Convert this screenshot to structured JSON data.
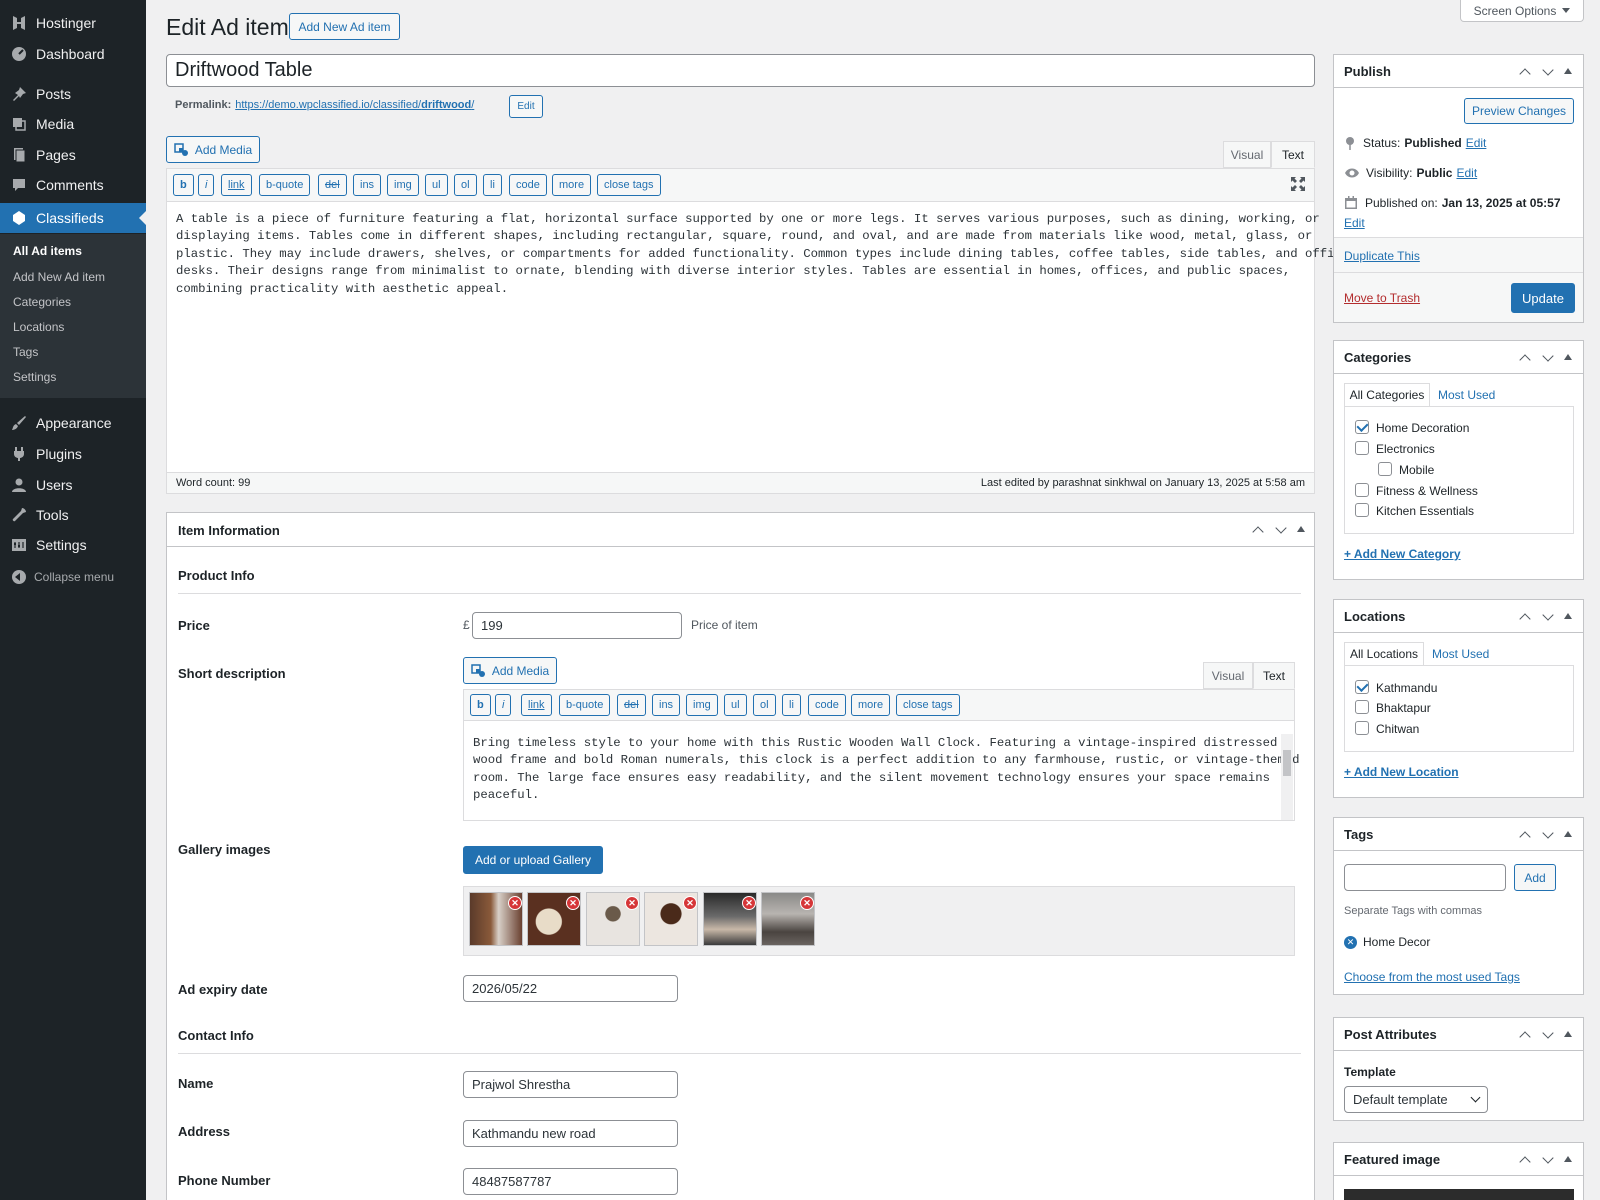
{
  "screen_options": "Screen Options",
  "sidebar": {
    "brand": "Hostinger",
    "items": [
      {
        "label": "Dashboard"
      },
      {
        "label": "Posts"
      },
      {
        "label": "Media"
      },
      {
        "label": "Pages"
      },
      {
        "label": "Comments"
      },
      {
        "label": "Classifieds"
      },
      {
        "label": "Appearance"
      },
      {
        "label": "Plugins"
      },
      {
        "label": "Users"
      },
      {
        "label": "Tools"
      },
      {
        "label": "Settings"
      }
    ],
    "submenu": [
      "All Ad items",
      "Add New Ad item",
      "Categories",
      "Locations",
      "Tags",
      "Settings"
    ],
    "collapse": "Collapse menu"
  },
  "header": {
    "title": "Edit Ad item",
    "add_new": "Add New Ad item"
  },
  "post": {
    "title": "Driftwood Table",
    "permalink_label": "Permalink:",
    "permalink_base": "https://demo.wpclassified.io/classified/",
    "permalink_slug": "driftwood",
    "permalink_end": "/",
    "permalink_edit": "Edit"
  },
  "editor": {
    "add_media": "Add Media",
    "tab_visual": "Visual",
    "tab_text": "Text",
    "quicktags": [
      "b",
      "i",
      "link",
      "b-quote",
      "del",
      "ins",
      "img",
      "ul",
      "ol",
      "li",
      "code",
      "more",
      "close tags"
    ],
    "content": "A table is a piece of furniture featuring a flat, horizontal surface supported by one or more legs. It serves various purposes, such as dining, working, or\ndisplaying items. Tables come in different shapes, including rectangular, square, round, and oval, and are made from materials like wood, metal, glass, or\nplastic. They may include drawers, shelves, or compartments for added functionality. Common types include dining tables, coffee tables, side tables, and office\ndesks. Their designs range from minimalist to ornate, blending with diverse interior styles. Tables are essential in homes, offices, and public spaces,\ncombining practicality with aesthetic appeal.",
    "word_count": "Word count: 99",
    "last_edited": "Last edited by parashnat sinkhwal on January 13, 2025 at 5:58 am"
  },
  "item_info": {
    "title": "Item Information",
    "product_info": "Product Info",
    "price_label": "Price",
    "currency": "£",
    "price_value": "199",
    "price_hint": "Price of item",
    "short_desc_label": "Short description",
    "short_desc_content": "Bring timeless style to your home with this Rustic Wooden Wall Clock. Featuring a vintage-inspired distressed\nwood frame and bold Roman numerals, this clock is a perfect addition to any farmhouse, rustic, or vintage-themed\nroom. The large face ensures easy readability, and the silent movement technology ensures your space remains\npeaceful.",
    "gallery_label": "Gallery images",
    "gallery_button": "Add or upload Gallery",
    "expiry_label": "Ad expiry date",
    "expiry_value": "2026/05/22",
    "contact_info": "Contact Info",
    "name_label": "Name",
    "name_value": "Prajwol Shrestha",
    "address_label": "Address",
    "address_value": "Kathmandu new road",
    "phone_label": "Phone Number",
    "phone_value": "48487587787"
  },
  "publish": {
    "title": "Publish",
    "preview": "Preview Changes",
    "status_label": "Status:",
    "status_value": "Published",
    "visibility_label": "Visibility:",
    "visibility_value": "Public",
    "published_label": "Published on:",
    "published_value": "Jan 13, 2025 at 05:57",
    "edit": "Edit",
    "duplicate": "Duplicate This",
    "trash": "Move to Trash",
    "update": "Update"
  },
  "categories": {
    "title": "Categories",
    "tab_all": "All Categories",
    "tab_most": "Most Used",
    "items": [
      "Home Decoration",
      "Electronics",
      "Mobile",
      "Fitness & Wellness",
      "Kitchen Essentials"
    ],
    "add_new": "+ Add New Category"
  },
  "locations": {
    "title": "Locations",
    "tab_all": "All Locations",
    "tab_most": "Most Used",
    "items": [
      "Kathmandu",
      "Bhaktapur",
      "Chitwan"
    ],
    "add_new": "+ Add New Location"
  },
  "tags": {
    "title": "Tags",
    "add": "Add",
    "hint": "Separate Tags with commas",
    "tag": "Home Decor",
    "choose": "Choose from the most used Tags"
  },
  "post_attributes": {
    "title": "Post Attributes",
    "template_label": "Template",
    "template_value": "Default template"
  },
  "featured_image": {
    "title": "Featured image"
  },
  "colors": {
    "admin_bar": "#1d2327",
    "accent": "#2271b1",
    "trash": "#b32d2e",
    "remove": "#d63638"
  }
}
